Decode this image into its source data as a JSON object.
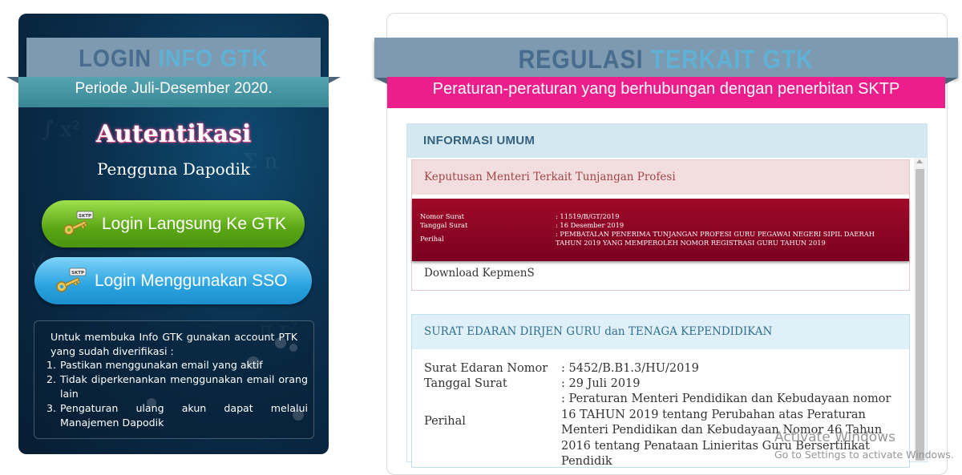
{
  "login_panel": {
    "ribbon_title_main": "LOGIN",
    "ribbon_title_accent": "INFO GTK",
    "periode": "Periode Juli-Desember 2020.",
    "auth_title": "Autentikasi",
    "auth_subtitle": "Pengguna Dapodik",
    "buttons": {
      "login_gtk": "Login Langsung Ke GTK",
      "login_sso": "Login Menggunakan SSO",
      "key_tag": "SKTP"
    },
    "info": {
      "intro": "Untuk membuka Info GTK gunakan account PTK yang sudah diverifikasi :",
      "items": [
        "Pastikan menggunakan email yang aktif",
        "Tidak diperkenankan menggunakan email orang lain",
        "Pengaturan ulang akun dapat melalui Manajemen Dapodik"
      ]
    }
  },
  "regulasi_panel": {
    "ribbon_title_main": "REGULASI",
    "ribbon_title_accent": "TERKAIT GTK",
    "subtitle": "Peraturan-peraturan yang berhubungan dengan penerbitan SKTP",
    "section_title": "INFORMASI UMUM",
    "card_keputusan": {
      "title": "Keputusan Menteri Terkait Tunjangan Profesi",
      "nomor_label": "Nomor Surat",
      "nomor_value": ": 11519/B/GT/2019",
      "tanggal_label": "Tanggal Surat",
      "tanggal_value": ": 16 Desember 2019",
      "perihal_label": "Perihal",
      "perihal_value": ": PEMBATALAN PENERIMA TUNJANGAN PROFESI GURU PEGAWAI NEGERI SIPIL DAERAH TAHUN 2019 YANG MEMPEROLEH NOMOR REGISTRASI GURU TAHUN 2019",
      "download": "Download KepmenS"
    },
    "card_surat_edaran": {
      "title": "SURAT EDARAN DIRJEN GURU dan TENAGA KEPENDIDIKAN",
      "nomor_label": "Surat Edaran Nomor",
      "nomor_value": ": 5452/B.B1.3/HU/2019",
      "tanggal_label": "Tanggal Surat",
      "tanggal_value": ": 29 Juli 2019",
      "perihal_label": "Perihal",
      "perihal_value": ": Peraturan Menteri Pendidikan dan Kebudayaan nomor 16 TAHUN 2019 tentang Perubahan atas Peraturan Menteri Pendidikan dan Kebudayaan Nomor 46 Tahun 2016 tentang Penataan Linieritas Guru Bersertifikat Pendidik"
    }
  },
  "watermark": {
    "title": "Activate Windows",
    "subtitle": "Go to Settings to activate Windows."
  },
  "colors": {
    "ribbon": "#7d9ab0",
    "ribbon_text": "#486c8d",
    "ribbon_accent": "#5fb1d6",
    "pink": "#ec1e8c",
    "maroon": "#8c0a25",
    "green_button": "#6cbd1f",
    "blue_button": "#2aa3e0"
  },
  "icons": [
    "key-icon",
    "scroll-up-arrow-icon"
  ]
}
